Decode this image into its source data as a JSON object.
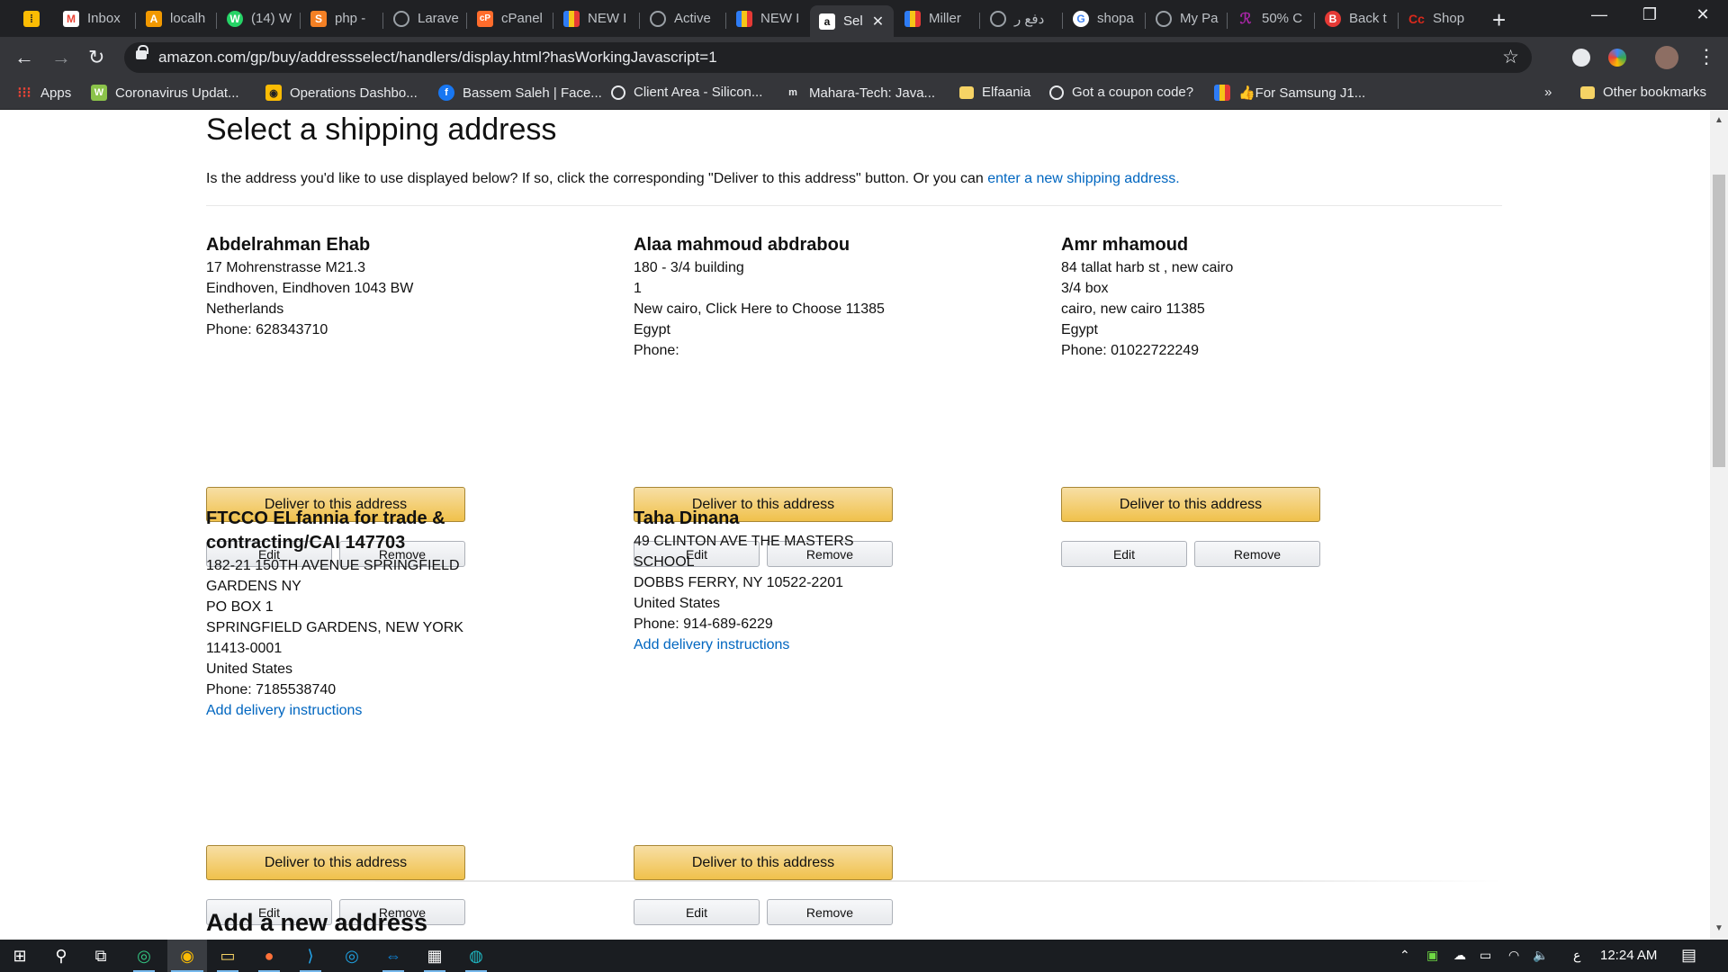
{
  "browser": {
    "tabs": [
      {
        "label": "Inbox",
        "icon": "gmail-icon",
        "color": "#ea4335",
        "glyph": "M"
      },
      {
        "label": "localh",
        "icon": "localhost-icon",
        "color": "#f29900",
        "glyph": "A"
      },
      {
        "label": "(14) W",
        "icon": "whatsapp-icon",
        "color": "#25d366",
        "glyph": "W"
      },
      {
        "label": "php - ",
        "icon": "stackoverflow-icon",
        "color": "#f48024",
        "glyph": "S"
      },
      {
        "label": "Larave",
        "icon": "globe-icon",
        "color": "#5f6368",
        "glyph": "○"
      },
      {
        "label": "cPanel",
        "icon": "cpanel-icon",
        "color": "#ff6c2c",
        "glyph": "cP"
      },
      {
        "label": "NEW I",
        "icon": "trello-icon",
        "color": "#e2c331",
        "glyph": "▌"
      },
      {
        "label": "Active",
        "icon": "active-icon",
        "color": "#5f6368",
        "glyph": "◐"
      },
      {
        "label": "NEW I",
        "icon": "trello-icon",
        "color": "#e2c331",
        "glyph": "▌"
      },
      {
        "label": "Sel",
        "icon": "amazon-icon",
        "color": "#ffffff",
        "glyph": "a",
        "active": true
      },
      {
        "label": "Miller",
        "icon": "trello-icon",
        "color": "#e2c331",
        "glyph": "▌"
      },
      {
        "label": "دفع ر",
        "icon": "globe-icon",
        "color": "#5f6368",
        "glyph": "○"
      },
      {
        "label": "shopa",
        "icon": "google-icon",
        "color": "#4285f4",
        "glyph": "G"
      },
      {
        "label": "My Pa",
        "icon": "globe-icon",
        "color": "#5f6368",
        "glyph": "○"
      },
      {
        "label": "50% C",
        "icon": "coupon-icon",
        "color": "#a626a4",
        "glyph": "ℛ"
      },
      {
        "label": "Back t",
        "icon": "back-icon",
        "color": "#e53935",
        "glyph": "B"
      },
      {
        "label": "Shop",
        "icon": "cc-icon",
        "color": "#da291c",
        "glyph": "Cc"
      }
    ],
    "url": "amazon.com/gp/buy/addressselect/handlers/display.html?hasWorkingJavascript=1",
    "bookmarks": [
      {
        "label": "Apps",
        "icon": "apps-grid-icon"
      },
      {
        "label": "Coronavirus Updat...",
        "icon": "worldometer-icon"
      },
      {
        "label": "Operations Dashbo...",
        "icon": "dashboard-icon"
      },
      {
        "label": "Bassem Saleh | Face...",
        "icon": "facebook-icon"
      },
      {
        "label": "Client Area - Silicon...",
        "icon": "globe-icon"
      },
      {
        "label": "Mahara-Tech: Java...",
        "icon": "maharatech-icon"
      },
      {
        "label": "Elfaania",
        "icon": "folder-icon"
      },
      {
        "label": "Got a coupon code?",
        "icon": "globe-icon"
      },
      {
        "label": "👍For Samsung J1...",
        "icon": "trello-icon"
      }
    ],
    "bookmarks_overflow": "»",
    "other_bookmarks": "Other bookmarks"
  },
  "page": {
    "title": "Select a shipping address",
    "intro": "Is the address you'd like to use displayed below? If so, click the corresponding \"Deliver to this address\" button. Or you can ",
    "intro_link": "enter a new shipping address.",
    "deliver_label": "Deliver to this address",
    "edit_label": "Edit",
    "remove_label": "Remove",
    "addresses": [
      {
        "name": "Abdelrahman Ehab",
        "lines": [
          "17 Mohrenstrasse M21.3",
          "Eindhoven, Eindhoven 1043 BW",
          "Netherlands",
          "Phone: 628343710"
        ]
      },
      {
        "name": "Alaa mahmoud abdrabou",
        "lines": [
          "180 - 3/4 building",
          "1",
          "New cairo, Click Here to Choose 11385",
          "Egypt",
          "Phone:"
        ]
      },
      {
        "name": "Amr mhamoud",
        "lines": [
          "84 tallat harb st , new cairo",
          "3/4 box",
          "cairo, new cairo 11385",
          "Egypt",
          "Phone: 01022722249"
        ]
      },
      {
        "name": "FTCCO ELfannia for trade & contracting/CAI 147703",
        "lines": [
          "182-21 150TH AVENUE SPRINGFIELD GARDENS NY",
          "PO BOX 1",
          "SPRINGFIELD GARDENS, NEW YORK 11413-0001",
          "United States",
          "Phone: 7185538740"
        ],
        "instructions": "Add delivery instructions"
      },
      {
        "name": "Taha Dinana",
        "lines": [
          "49 CLINTON AVE THE MASTERS SCHOOL",
          "DOBBS FERRY, NY 10522-2201",
          "United States",
          "Phone: 914-689-6229"
        ],
        "instructions": "Add delivery instructions"
      }
    ],
    "add_heading": "Add a new address"
  },
  "taskbar": {
    "time": "12:24 AM",
    "lang": "ع"
  },
  "colors": {
    "link": "#0066c0",
    "deliver_button": "#f0c14b",
    "chrome_dark": "#202124"
  }
}
